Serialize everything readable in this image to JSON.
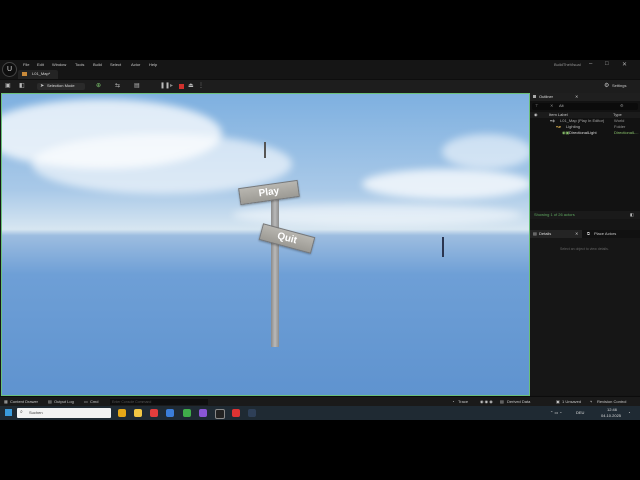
{
  "menu": {
    "logo_text": "U",
    "items": [
      "File",
      "Edit",
      "Window",
      "Tools",
      "Build",
      "Select",
      "Actor",
      "Help"
    ],
    "project_name": "BuildTheVisual"
  },
  "tabs": {
    "level_tab": "L01_Map*"
  },
  "toolbar": {
    "mode_label": "Selection Mode",
    "settings_label": "Settings"
  },
  "viewport": {
    "signs": {
      "play": "Play",
      "quit": "Quit"
    }
  },
  "outliner": {
    "title": "Outliner",
    "search_placeholder": "Alt",
    "col_label": "Item Label",
    "col_type": "Type",
    "rows": [
      {
        "label": "L01_Map (Play In Editor)",
        "type": "World"
      },
      {
        "label": "Lighting",
        "type": "Folder"
      },
      {
        "label": "DirectionalLight",
        "type": "DirectionalL..."
      }
    ],
    "status": "Showing 1 of 26 actors"
  },
  "details": {
    "tab_details": "Details",
    "tab_place": "Place Actors",
    "empty_text": "Select an object to view details."
  },
  "bottombar": {
    "content_drawer": "Content Drawer",
    "output_log": "Output Log",
    "cmd": "Cmd",
    "console_placeholder": "Enter Console Command",
    "trace": "Trace",
    "derived_data": "Derived Data",
    "unsaved": "1 Unsaved",
    "revision_control": "Revision Control"
  },
  "taskbar": {
    "search_label": "Suchen",
    "lang": "DEU",
    "time": "12:46",
    "date": "04.10.2025"
  },
  "colors": {
    "viewport_border": "#6ac07a",
    "stop_button": "#d0312d",
    "status_green": "#5fa85f"
  }
}
